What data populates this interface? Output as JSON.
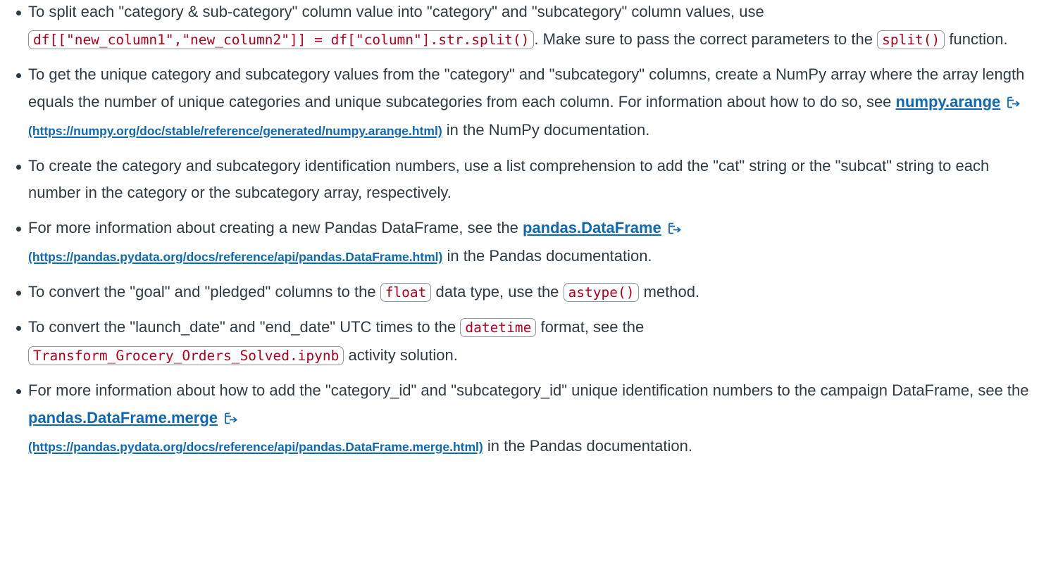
{
  "bullets": [
    {
      "t1": "To split each \"category & sub-category\" column value into \"category\" and \"subcategory\" column values, use",
      "code1": "df[[\"new_column1\",\"new_column2\"]] = df[\"column\"].str.split()",
      "t2": ". Make sure to pass the correct parameters to the",
      "code2": "split()",
      "t3": "function."
    },
    {
      "t1": "To get the unique category and subcategory values from the \"category\" and \"subcategory\" columns, create a NumPy array where the array length equals the number of unique categories and unique subcategories from each column. For information about how to do so, see",
      "link": "numpy.arange",
      "url": "(https://numpy.org/doc/stable/reference/generated/numpy.arange.html)",
      "t2": "in the NumPy documentation."
    },
    {
      "t1": "To create the category and subcategory identification numbers, use a list comprehension to add the \"cat\" string or the \"subcat\" string to each number in the category or the subcategory array, respectively."
    },
    {
      "t1": "For more information about creating a new Pandas DataFrame, see the",
      "link": "pandas.DataFrame",
      "url": "(https://pandas.pydata.org/docs/reference/api/pandas.DataFrame.html)",
      "t2": "in the Pandas documentation."
    },
    {
      "t1": "To convert the \"goal\" and \"pledged\" columns to the",
      "code1": "float",
      "t2": "data type, use the",
      "code2": "astype()",
      "t3": "method."
    },
    {
      "t1": "To convert the \"launch_date\" and \"end_date\" UTC times to the",
      "code1": "datetime",
      "t2": "format, see the",
      "code2": "Transform_Grocery_Orders_Solved.ipynb",
      "t3": "activity solution."
    },
    {
      "t1": "For more information about how to add the \"category_id\" and \"subcategory_id\" unique identification numbers to the campaign DataFrame, see the",
      "link": "pandas.DataFrame.merge",
      "url": "(https://pandas.pydata.org/docs/reference/api/pandas.DataFrame.merge.html)",
      "t2": "in the Pandas documentation."
    }
  ],
  "icons": {
    "external_link": "external-link-icon"
  },
  "colors": {
    "text": "#2d3b45",
    "code": "#b1001c",
    "link": "#0e68b3"
  }
}
